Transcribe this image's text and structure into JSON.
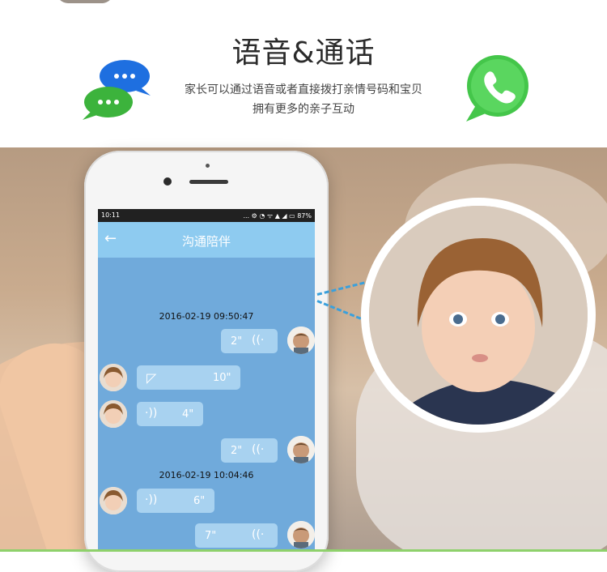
{
  "banner": {
    "title": "语音&通话",
    "desc_line1": "家长可以通过语音或者直接拨打亲情号码和宝贝",
    "desc_line2": "拥有更多的亲子互动",
    "chat_icon": "chat-bubbles-icon",
    "call_icon": "whatsapp-phone-icon"
  },
  "phone": {
    "status": {
      "time": "10:11",
      "indicators": "... ⚙ ◔ ᯤ ▲ ◢ ▭ 87%"
    },
    "appbar": {
      "title": "沟通陪伴",
      "back_icon": "arrow-left-icon"
    },
    "messages": [
      {
        "type": "timestamp",
        "text": "2016-02-19 09:50:47"
      },
      {
        "type": "voice",
        "side": "right",
        "duration": "2\"",
        "sender": "parent"
      },
      {
        "type": "voice",
        "side": "left",
        "duration": "10\"",
        "sender": "child",
        "icon": "headphones-icon"
      },
      {
        "type": "voice",
        "side": "left",
        "duration": "4\"",
        "sender": "child"
      },
      {
        "type": "voice",
        "side": "right",
        "duration": "2\"",
        "sender": "parent"
      },
      {
        "type": "timestamp",
        "text": "2016-02-19 10:04:46"
      },
      {
        "type": "voice",
        "side": "left",
        "duration": "6\"",
        "sender": "child"
      },
      {
        "type": "voice",
        "side": "right",
        "duration": "7\"",
        "sender": "parent"
      }
    ]
  },
  "colors": {
    "screen_bg": "#70aadb",
    "appbar_bg": "#8ecbf0",
    "bubble_bg": "#a8d2f0",
    "accent_dash": "#3aa0dc",
    "chat_blue": "#1e6fe0",
    "chat_green": "#3cb33c",
    "whatsapp_green": "#44c64a"
  }
}
